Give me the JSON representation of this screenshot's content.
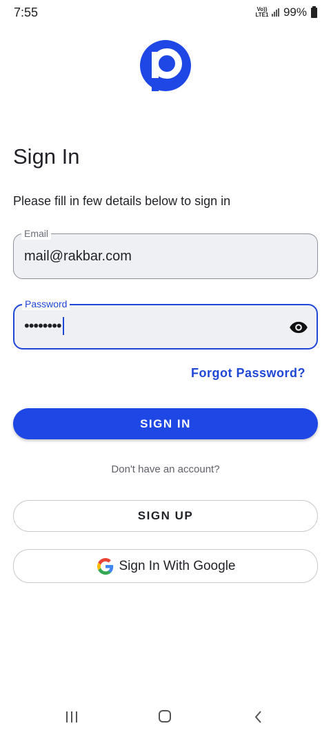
{
  "status_bar": {
    "time": "7:55",
    "network_label": "Vo)) LTE1",
    "battery": "99%"
  },
  "logo": {
    "icon": "brand-p-logo",
    "color": "#1e47e6"
  },
  "title": "Sign In",
  "subtitle": "Please fill in few details below to sign in",
  "email_field": {
    "label": "Email",
    "value": "mail@rakbar.com"
  },
  "password_field": {
    "label": "Password",
    "value": "••••••••",
    "toggle_icon": "eye-icon"
  },
  "forgot_password": "Forgot Password?",
  "sign_in_button": "SIGN IN",
  "no_account_text": "Don't have an account?",
  "sign_up_button": "SIGN UP",
  "google_button": "Sign In With Google",
  "colors": {
    "accent": "#1e47e6",
    "field_bg": "#eff0f3"
  }
}
